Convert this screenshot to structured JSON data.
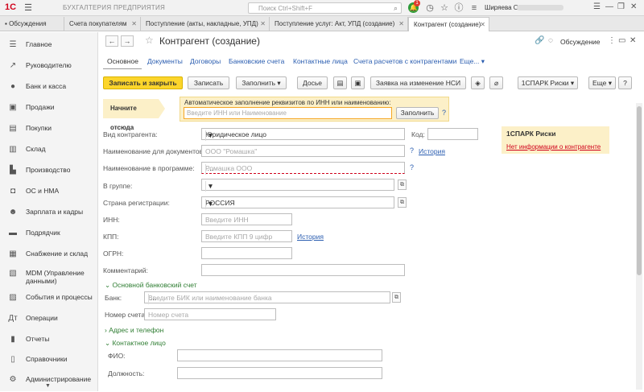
{
  "app": {
    "logo": "1С",
    "breadcrumb": "БУХГАЛТЕРИЯ ПРЕДПРИЯТИЯ",
    "search_placeholder": "Поиск Ctrl+Shift+F",
    "notif_count": "1",
    "user": "Ширяева Олеся"
  },
  "tabs": [
    {
      "label": "Обсуждения"
    },
    {
      "label": "Счета покупателям"
    },
    {
      "label": "Поступление (акты, накладные, УПД)"
    },
    {
      "label": "Поступление услуг: Акт, УПД (создание)"
    },
    {
      "label": "Контрагент (создание)"
    }
  ],
  "sidebar": {
    "items": [
      {
        "label": "Главное",
        "icon": "menu-icon"
      },
      {
        "label": "Руководителю",
        "icon": "chart-line-icon"
      },
      {
        "label": "Банк и касса",
        "icon": "coins-icon"
      },
      {
        "label": "Продажи",
        "icon": "bag-icon"
      },
      {
        "label": "Покупки",
        "icon": "cart-icon"
      },
      {
        "label": "Склад",
        "icon": "warehouse-icon"
      },
      {
        "label": "Производство",
        "icon": "factory-icon"
      },
      {
        "label": "ОС и НМА",
        "icon": "car-icon"
      },
      {
        "label": "Зарплата и кадры",
        "icon": "people-icon"
      },
      {
        "label": "Подрядчик",
        "icon": "truck-icon"
      },
      {
        "label": "Снабжение и склад",
        "icon": "box-icon"
      },
      {
        "label": "MDM (Управление данными)",
        "icon": "database-icon"
      },
      {
        "label": "События и процессы",
        "icon": "calendar-icon"
      },
      {
        "label": "Операции",
        "icon": "operations-icon"
      },
      {
        "label": "Отчеты",
        "icon": "report-icon"
      },
      {
        "label": "Справочники",
        "icon": "book-icon"
      },
      {
        "label": "Администрирование",
        "icon": "gear-icon"
      }
    ]
  },
  "form": {
    "title": "Контрагент (создание)",
    "discussion": "Обсуждение",
    "links": [
      "Основное",
      "Документы",
      "Договоры",
      "Банковские счета",
      "Контактные лица",
      "Счета расчетов с контрагентами",
      "Еще..."
    ],
    "toolbar": {
      "save_close": "Записать и закрыть",
      "save": "Записать",
      "fill": "Заполнить",
      "dossier": "Досье",
      "nsi_request": "Заявка на изменение НСИ",
      "spark": "1СПАРК Риски",
      "more": "Еще"
    },
    "autofill": {
      "hint": "Начните отсюда",
      "caption": "Автоматическое заполнение реквизитов по ИНН или наименованию:",
      "placeholder": "Введите ИНН или Наименование",
      "button": "Заполнить"
    },
    "fields": {
      "kind_label": "Вид контрагента:",
      "kind_value": "Юридическое лицо",
      "code_label": "Код:",
      "doc_name_label": "Наименование для документов:",
      "doc_name_ph": "ООО \"Ромашка\"",
      "history": "История",
      "prog_name_label": "Наименование в программе:",
      "prog_name_ph": "Ромашка ООО",
      "group_label": "В группе:",
      "country_label": "Страна регистрации:",
      "country_value": "РОССИЯ",
      "inn_label": "ИНН:",
      "inn_ph": "Введите ИНН",
      "kpp_label": "КПП:",
      "kpp_ph": "Введите КПП 9 цифр",
      "ogrn_label": "ОГРН:",
      "comment_label": "Комментарий:"
    },
    "bank": {
      "section": "Основной банковский счет",
      "bank_label": "Банк:",
      "bank_ph": "Введите БИК или наименование банка",
      "account_label": "Номер счета:",
      "account_ph": "Номер счета"
    },
    "address_section": "Адрес и телефон",
    "contact": {
      "section": "Контактное лицо",
      "fio_label": "ФИО:",
      "position_label": "Должность:"
    },
    "spark_panel": {
      "title": "1СПАРК Риски",
      "link": "Нет информации о контрагенте"
    }
  }
}
